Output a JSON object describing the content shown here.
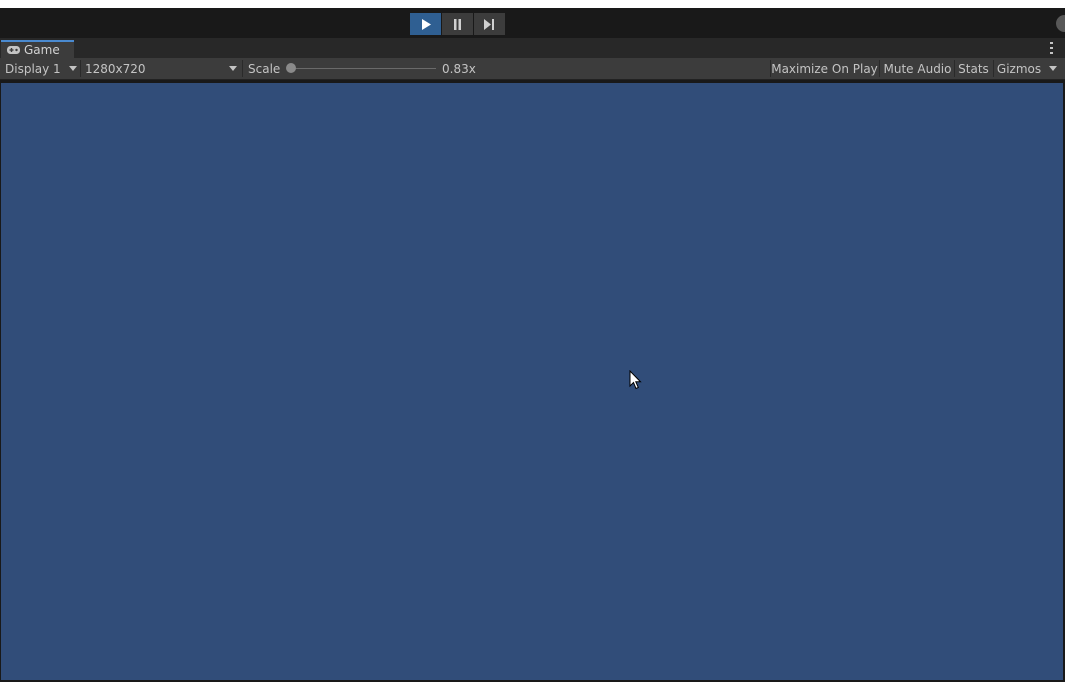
{
  "toolbar": {
    "play_state": "playing",
    "buttons": [
      {
        "name": "play",
        "icon": "play-icon",
        "active": true
      },
      {
        "name": "pause",
        "icon": "pause-icon",
        "active": false
      },
      {
        "name": "step",
        "icon": "step-icon",
        "active": false
      }
    ]
  },
  "tab": {
    "icon": "gamepad-icon",
    "label": "Game"
  },
  "gamebar": {
    "display": "Display 1",
    "resolution": "1280x720",
    "scale_label": "Scale",
    "scale_value": "0.83x",
    "scale_level": 0.0,
    "maximize_on_play": "Maximize On Play",
    "mute_audio": "Mute Audio",
    "stats": "Stats",
    "gizmos": "Gizmos"
  },
  "colors": {
    "viewport_background": "#314d79",
    "play_active": "#2f5f92",
    "tab_accent": "#4a8ad0"
  }
}
